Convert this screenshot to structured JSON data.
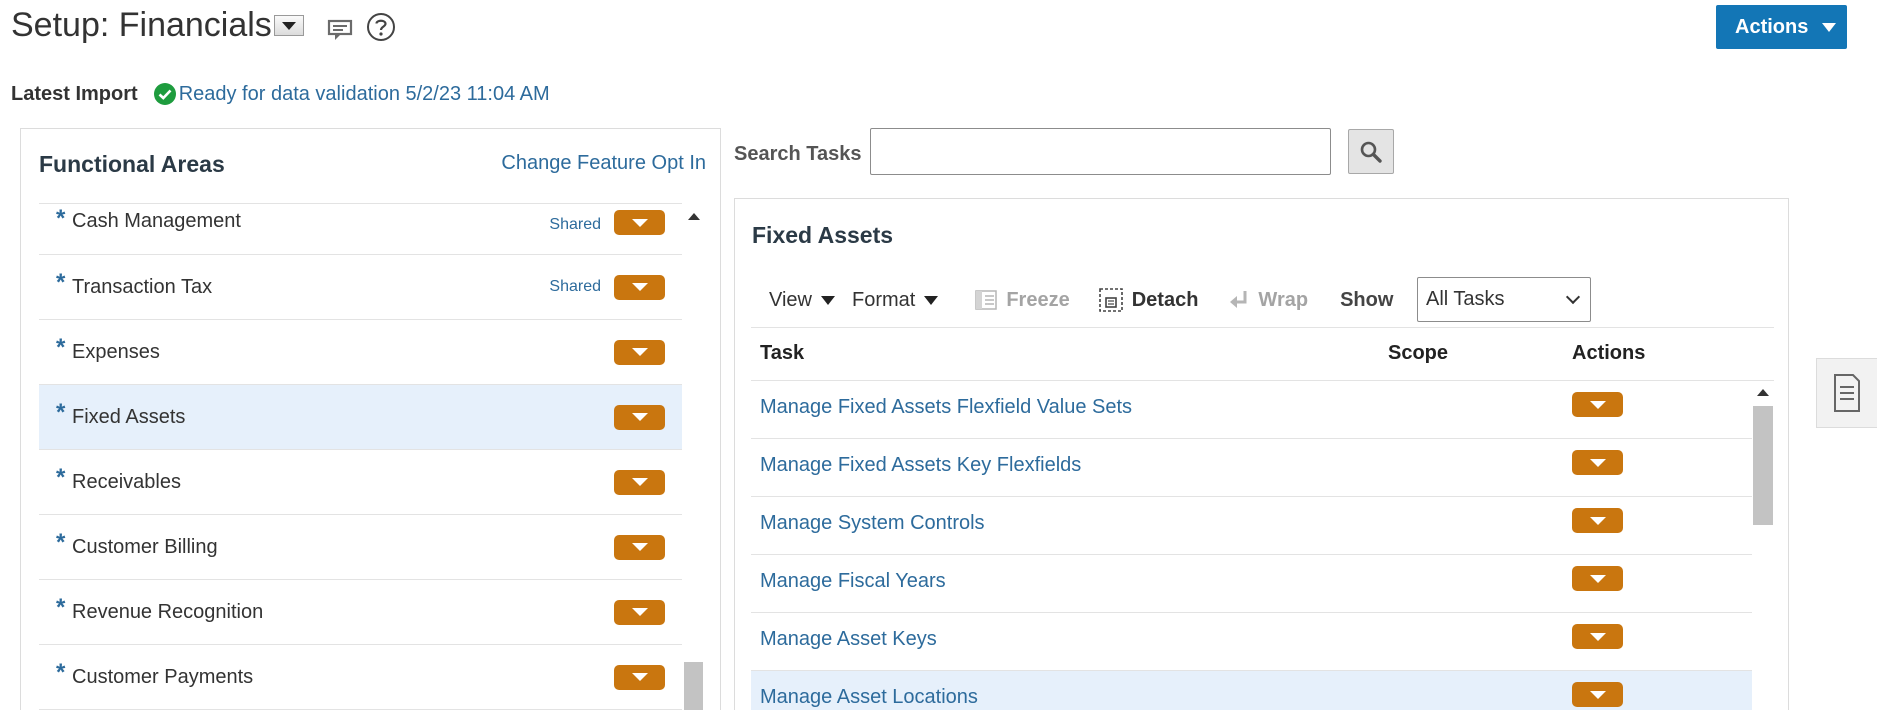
{
  "header": {
    "title": "Setup: Financials",
    "actions_label": "Actions"
  },
  "import": {
    "label": "Latest Import",
    "status": "Ready for data validation 5/2/23 11:04 AM"
  },
  "functional_areas": {
    "title": "Functional Areas",
    "change_link": "Change Feature Opt In",
    "items": [
      {
        "star": "*",
        "name": "Cash Management",
        "shared": "Shared"
      },
      {
        "star": "*",
        "name": "Transaction Tax",
        "shared": "Shared"
      },
      {
        "star": "*",
        "name": "Expenses",
        "shared": ""
      },
      {
        "star": "*",
        "name": "Fixed Assets",
        "shared": "",
        "selected": true
      },
      {
        "star": "*",
        "name": "Receivables",
        "shared": ""
      },
      {
        "star": "*",
        "name": "Customer Billing",
        "shared": ""
      },
      {
        "star": "*",
        "name": "Revenue Recognition",
        "shared": ""
      },
      {
        "star": "*",
        "name": "Customer Payments",
        "shared": ""
      }
    ]
  },
  "search": {
    "label": "Search Tasks",
    "value": ""
  },
  "tasks_panel": {
    "title": "Fixed Assets",
    "toolbar": {
      "view": "View",
      "format": "Format",
      "freeze": "Freeze",
      "detach": "Detach",
      "wrap": "Wrap",
      "show_label": "Show",
      "show_value": "All Tasks"
    },
    "columns": {
      "task": "Task",
      "scope": "Scope",
      "actions": "Actions"
    },
    "rows": [
      {
        "task": "Manage Fixed Assets Flexfield Value Sets"
      },
      {
        "task": "Manage Fixed Assets Key Flexfields"
      },
      {
        "task": "Manage System Controls"
      },
      {
        "task": "Manage Fiscal Years"
      },
      {
        "task": "Manage Asset Keys"
      },
      {
        "task": "Manage Asset Locations",
        "selected": true
      }
    ]
  },
  "colors": {
    "accent_blue": "#1376b6",
    "link_blue": "#2d6b9c",
    "orange": "#c9760f",
    "selected_row": "#e6f0fb",
    "success_green": "#1e9c3e"
  }
}
